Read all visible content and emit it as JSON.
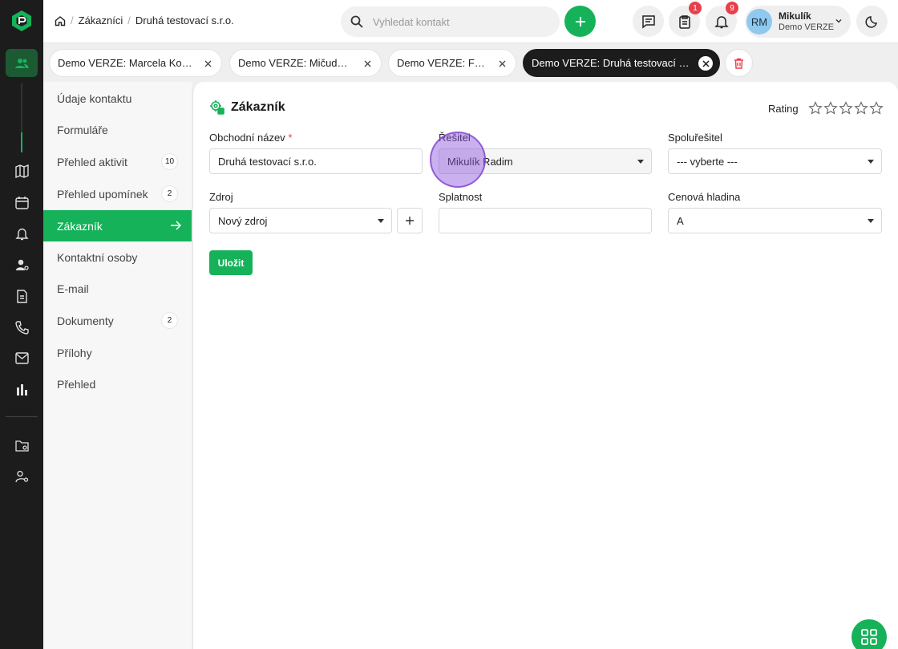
{
  "breadcrumb": {
    "items": [
      "Zákazníci",
      "Druhá testovací s.r.o."
    ],
    "separator": "/"
  },
  "search": {
    "placeholder": "Vyhledat kontakt"
  },
  "notifications": {
    "tasks_count": "1",
    "alerts_count": "9"
  },
  "user": {
    "initials": "RM",
    "name": "Mikulík",
    "org": "Demo VERZE"
  },
  "tabs": [
    {
      "label": "Demo VERZE: Marcela Konv..."
    },
    {
      "label": "Demo VERZE: Mičuda a.s."
    },
    {
      "label": "Demo VERZE: Franta"
    },
    {
      "label": "Demo VERZE: Druhá testovací s.r.o."
    }
  ],
  "menu": {
    "items": [
      {
        "label": "Údaje kontaktu",
        "count": ""
      },
      {
        "label": "Formuláře",
        "count": ""
      },
      {
        "label": "Přehled aktivit",
        "count": "10"
      },
      {
        "label": "Přehled upomínek",
        "count": "2"
      },
      {
        "label": "Zákazník",
        "count": ""
      },
      {
        "label": "Kontaktní osoby",
        "count": ""
      },
      {
        "label": "E-mail",
        "count": ""
      },
      {
        "label": "Dokumenty",
        "count": "2"
      },
      {
        "label": "Přílohy",
        "count": ""
      },
      {
        "label": "Přehled",
        "count": ""
      }
    ]
  },
  "form": {
    "title": "Zákazník",
    "rating_label": "Rating",
    "rating_value": 0,
    "rating_max": 5,
    "business_name_label": "Obchodní název",
    "business_name_value": "Druhá testovací s.r.o.",
    "required_mark": "*",
    "solver_label": "Řešitel",
    "solver_value": "Mikulík Radim",
    "cosolver_label": "Spoluřešitel",
    "cosolver_value": "--- vyberte ---",
    "source_label": "Zdroj",
    "source_value": "Nový zdroj",
    "due_label": "Splatnost",
    "due_value": "",
    "price_label": "Cenová hladina",
    "price_value": "A",
    "save_label": "Uložit"
  },
  "colors": {
    "accent": "#16b25a",
    "rail": "#1c1c1c",
    "badge": "#e8404a"
  }
}
